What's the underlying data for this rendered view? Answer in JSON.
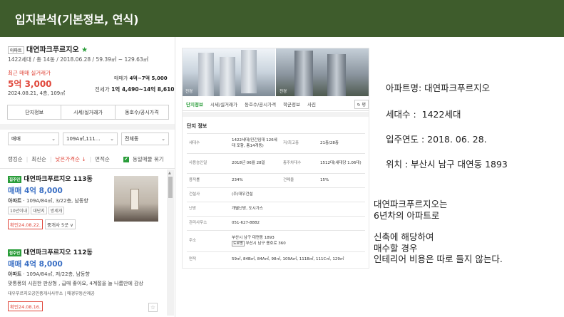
{
  "header": {
    "title": "입지분석(기본정보, 연식)"
  },
  "left": {
    "apt_badge": "아파트",
    "apt_name": "대연파크푸르지오",
    "star": "★",
    "apt_sub": "1422세대 / 총 14동 / 2018.06.28 / 59.39㎡ ~ 129.63㎡",
    "recent_label": "최근 매매 실거래가",
    "recent_price": "5억 3,000",
    "recent_date": "2024.08.21, 4층, 109㎡",
    "sale_label": "매매가",
    "sale_range": "4억~7억 5,000",
    "jeonse_label": "전세가",
    "jeonse_range": "1억 4,490~14억 8,610",
    "buttons": [
      "단지정보",
      "시세/실거래가",
      "동호수/공시가격"
    ],
    "filters": [
      {
        "value": "매매"
      },
      {
        "value": "109A㎡,111…"
      },
      {
        "value": "전체동"
      }
    ],
    "sort": {
      "items": [
        "랭킹순",
        "최신순",
        "낮은가격순 ↓",
        "면적순"
      ],
      "same_checkbox": "✔",
      "same_label": "동일매물 묶기"
    },
    "listings": [
      {
        "tag": "집주인",
        "title": "대연파크푸르지오 113동",
        "price": "매매 4억 8,000",
        "detail_prefix": "아파트",
        "detail": " · 109A/84㎡, 3/22층, 남동향",
        "tags": [
          "10년이내",
          "대단지",
          "방세개"
        ],
        "confirm": "확인24.08.22.",
        "broker": "중개사 5곳 ∨"
      },
      {
        "tag": "집주인",
        "title": "대연파크푸르지오 112동",
        "price": "매매 4억 8,000",
        "detail_prefix": "아파트",
        "detail": " · 109A/84㎡, 저/22층, 남동향",
        "desc": "맞통풍의 시원한 판상형 , 급매 좋아요, 4계절을 늘 나름만에 감상",
        "agent": "대우푸르지오공인중개사사무소 | 매경부동산제공",
        "confirm": "확인24.08.16.",
        "star": "☆"
      }
    ]
  },
  "middle": {
    "photo_caption_1": "전경",
    "photo_caption_2": "전경",
    "tabs": [
      "단지정보",
      "시세/실거래가",
      "동호수/공시가격",
      "학군정보",
      "사진"
    ],
    "tab_more": "↻ 평",
    "section_title": "단지 정보",
    "rows": [
      {
        "l1": "세대수",
        "v1": "1422세대(민간임대 126세대 포함, 총14개동)",
        "l2": "저/최고층",
        "v2": "21층/28층"
      },
      {
        "l1": "사용승인일",
        "v1": "2018년 06월 28일",
        "l2": "총주차대수",
        "v2": "1512대(세대당 1.06대)"
      },
      {
        "l1": "용적률",
        "v1": "234%",
        "l2": "건폐율",
        "v2": "15%"
      },
      {
        "l1": "건설사",
        "v1": "(주)대우건설"
      },
      {
        "l1": "난방",
        "v1": "개별난방, 도시가스"
      },
      {
        "l1": "관리사무소",
        "v1": "051-627-8882"
      },
      {
        "l1": "주소",
        "v1": "부산시 남구 대연동 1893",
        "road_tag": "도로명",
        "v1b": "부산시 남구 용호로 360"
      },
      {
        "l1": "면적",
        "v1": "59㎡, 84B㎡, 84A㎡, 98㎡, 109A㎡, 111B㎡, 111C㎡, 129㎡"
      }
    ]
  },
  "notes": {
    "apt_name": "아파트명: 대연파크푸르지오",
    "households": "세대수 :  1422세대",
    "move_in": "입주연도 : 2018. 06. 28.",
    "location": "위치 : 부산시 남구 대연동 1893",
    "para1": "대연파크푸르지오는",
    "para2": "6년차의 아파트로",
    "para3": "신축에 해당하여",
    "para4": "매수할 경우",
    "para5": "인테리어 비용은 따로 들지 않는다."
  }
}
